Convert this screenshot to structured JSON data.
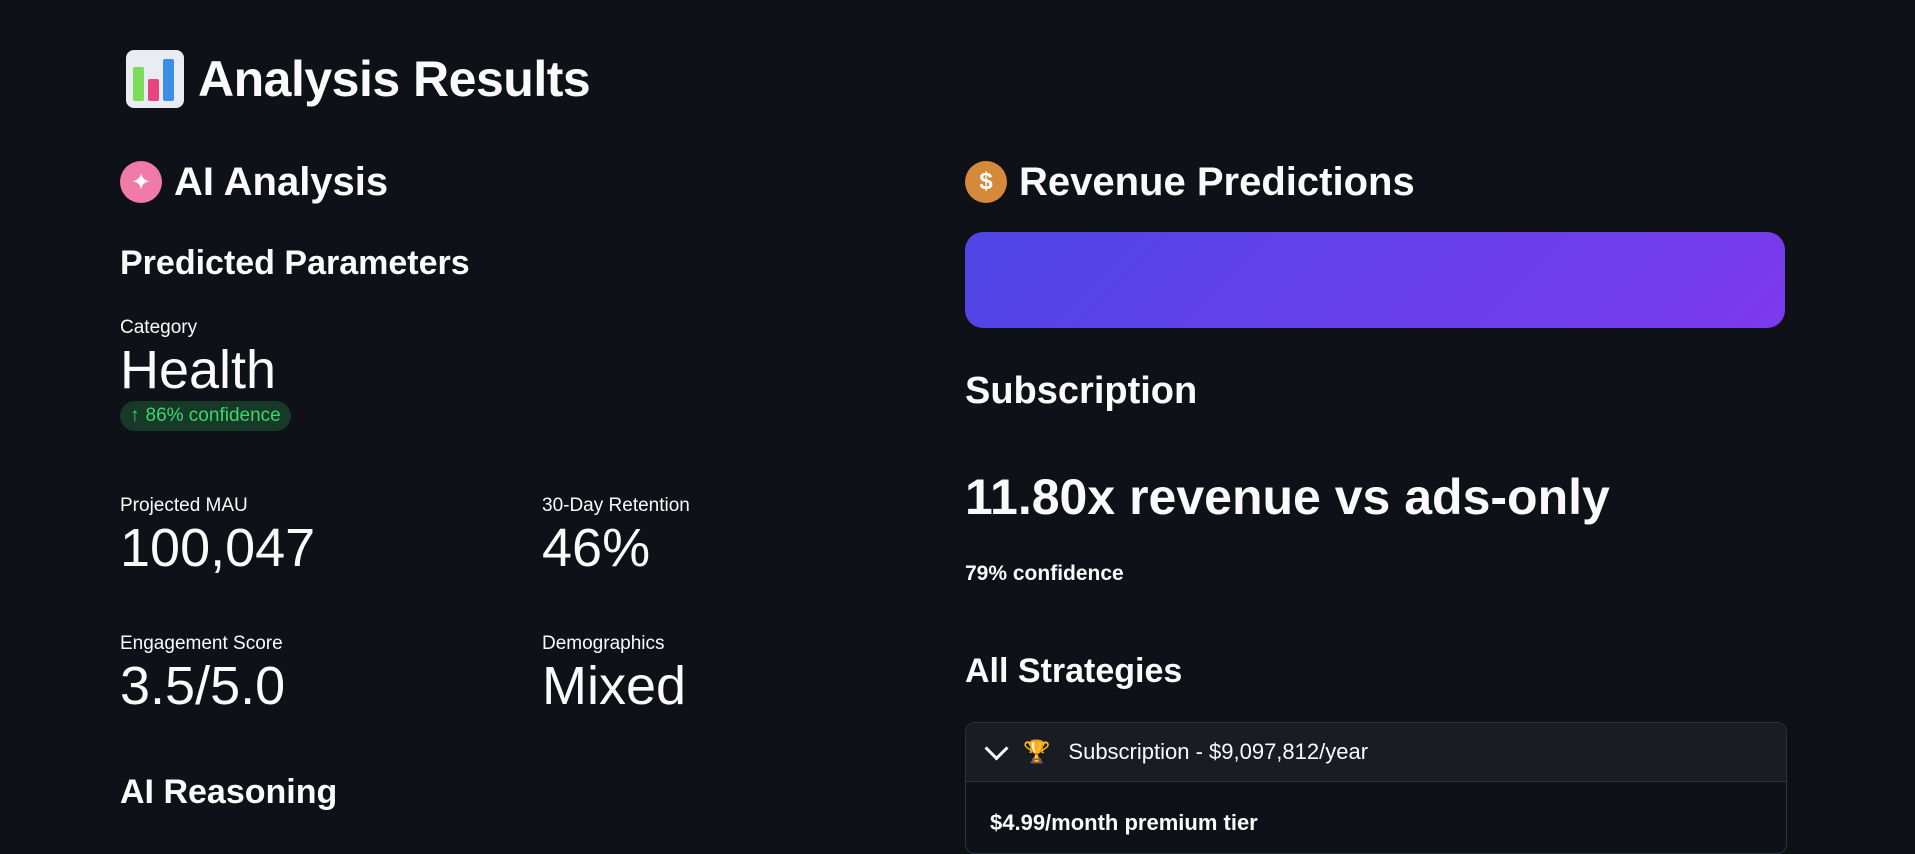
{
  "page": {
    "title": "Analysis Results"
  },
  "ai_analysis": {
    "heading": "AI Analysis",
    "predicted_params_heading": "Predicted Parameters",
    "category": {
      "label": "Category",
      "value": "Health",
      "delta": "86% confidence"
    },
    "metrics": [
      {
        "label": "Projected MAU",
        "value": "100,047"
      },
      {
        "label": "30-Day Retention",
        "value": "46%"
      },
      {
        "label": "Engagement Score",
        "value": "3.5/5.0"
      },
      {
        "label": "Demographics",
        "value": "Mixed"
      }
    ],
    "reasoning_heading": "AI Reasoning"
  },
  "revenue": {
    "heading": "Revenue Predictions",
    "strategy_name": "Subscription",
    "headline": "11.80x revenue vs ads-only",
    "confidence": "79% confidence",
    "all_strategies_heading": "All Strategies",
    "expander": {
      "label": "Subscription - $9,097,812/year",
      "detail": "$4.99/month premium tier"
    }
  },
  "colors": {
    "background": "#0e1117",
    "banner_start": "#4f46e5",
    "banner_end": "#7c3aed",
    "delta_green": "#3dd56d"
  },
  "icons": {
    "title": "bar-chart-icon",
    "ai": "brain-icon",
    "revenue": "money-bag-icon",
    "arrow": "arrow-up-icon",
    "expander": "chevron-down-icon",
    "trophy": "trophy-icon"
  }
}
